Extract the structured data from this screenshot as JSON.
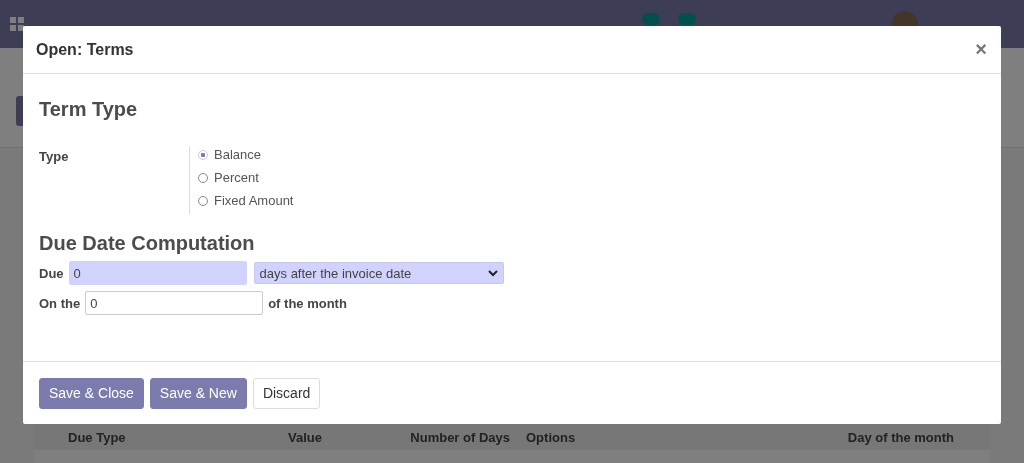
{
  "table": {
    "columns": [
      "Due Type",
      "Value",
      "Number of Days",
      "Options",
      "Day of the month"
    ]
  },
  "dialog": {
    "title": "Open: Terms",
    "close": "×",
    "term_heading": "Term Type",
    "type_label": "Type",
    "type_options": [
      {
        "label": "Balance",
        "selected": true
      },
      {
        "label": "Percent",
        "selected": false
      },
      {
        "label": "Fixed Amount",
        "selected": false
      }
    ],
    "due_heading": "Due Date Computation",
    "due_label": "Due",
    "due_value": "0",
    "due_option": "days after the invoice date",
    "on_the_label": "On the",
    "day_value": "0",
    "of_month_label": "of the month",
    "buttons": [
      {
        "label": "Save & Close",
        "kind": "primary"
      },
      {
        "label": "Save & New",
        "kind": "primary"
      },
      {
        "label": "Discard",
        "kind": "secondary"
      }
    ]
  }
}
